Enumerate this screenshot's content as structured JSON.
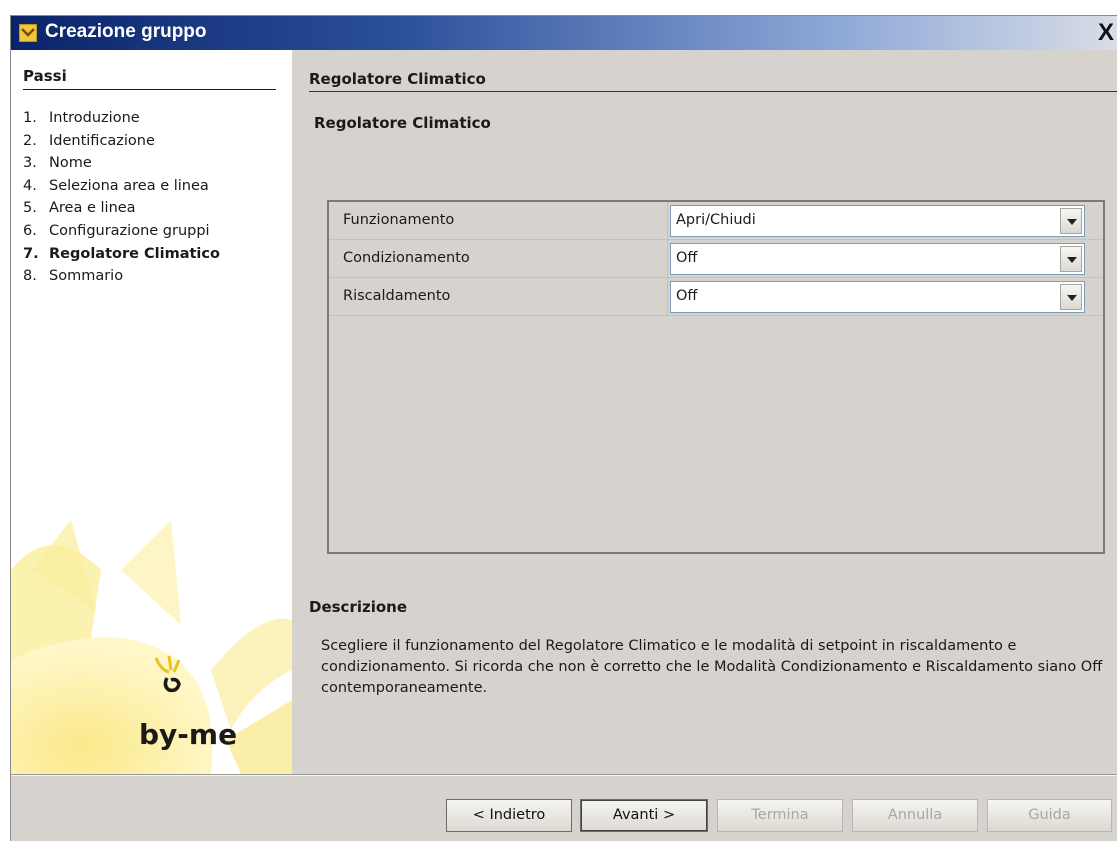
{
  "window": {
    "title": "Creazione gruppo",
    "close_label": "X"
  },
  "steps": {
    "heading": "Passi",
    "items": [
      {
        "num": "1.",
        "label": "Introduzione"
      },
      {
        "num": "2.",
        "label": "Identificazione"
      },
      {
        "num": "3.",
        "label": "Nome"
      },
      {
        "num": "4.",
        "label": "Seleziona area e linea"
      },
      {
        "num": "5.",
        "label": "Area e linea"
      },
      {
        "num": "6.",
        "label": "Configurazione gruppi"
      },
      {
        "num": "7.",
        "label": "Regolatore Climatico"
      },
      {
        "num": "8.",
        "label": "Sommario"
      }
    ],
    "active_index": 6,
    "logo_text": "by-me"
  },
  "main": {
    "section_title": "Regolatore Climatico",
    "subtitle": "Regolatore Climatico",
    "rows": [
      {
        "label": "Funzionamento",
        "value": "Apri/Chiudi"
      },
      {
        "label": "Condizionamento",
        "value": "Off"
      },
      {
        "label": "Riscaldamento",
        "value": "Off"
      }
    ],
    "description_title": "Descrizione",
    "description": "Scegliere il funzionamento del Regolatore Climatico e le modalità di setpoint in riscaldamento e condizionamento. Si ricorda che non è corretto che le Modalità Condizionamento e Riscaldamento siano Off contemporaneamente."
  },
  "buttons": {
    "back": "< Indietro",
    "next": "Avanti >",
    "finish": "Termina",
    "cancel": "Annulla",
    "help": "Guida"
  },
  "colors": {
    "titlebar_start": "#0a246a",
    "window_bg": "#d6d3ce",
    "logo_yellow": "#f2d84a"
  }
}
